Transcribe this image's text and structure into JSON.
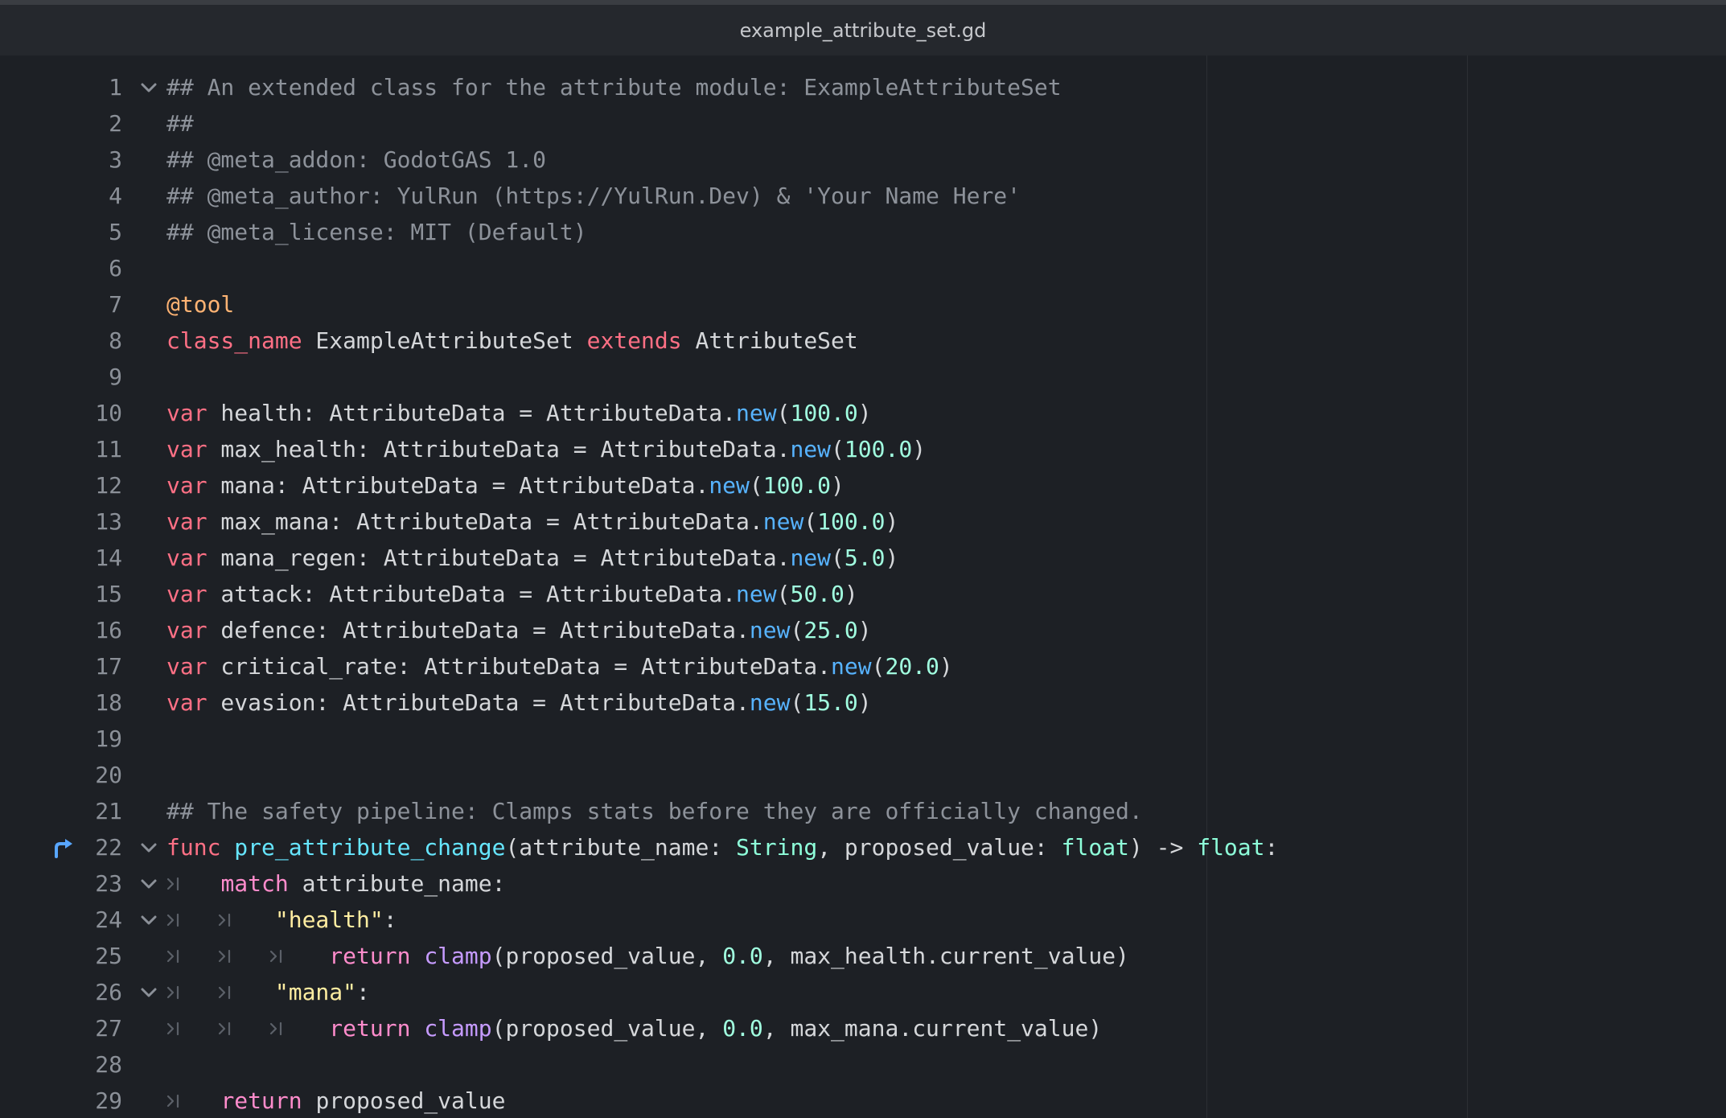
{
  "window": {
    "title": "example_attribute_set.gd"
  },
  "editor": {
    "lines": [
      {
        "n": "1",
        "tokens": [
          [
            "cm",
            "## An extended class for the attribute module: ExampleAttributeSet"
          ]
        ]
      },
      {
        "n": "2",
        "tokens": [
          [
            "cm",
            "##"
          ]
        ]
      },
      {
        "n": "3",
        "tokens": [
          [
            "cm",
            "## @meta_addon: GodotGAS 1.0"
          ]
        ]
      },
      {
        "n": "4",
        "tokens": [
          [
            "cm",
            "## @meta_author: YulRun (https://YulRun.Dev) & 'Your Name Here'"
          ]
        ]
      },
      {
        "n": "5",
        "tokens": [
          [
            "cm",
            "## @meta_license: MIT (Default)"
          ]
        ]
      },
      {
        "n": "6",
        "tokens": []
      },
      {
        "n": "7",
        "tokens": [
          [
            "an",
            "@tool"
          ]
        ]
      },
      {
        "n": "8",
        "tokens": [
          [
            "kw",
            "class_name"
          ],
          [
            "id",
            " ExampleAttributeSet "
          ],
          [
            "kw",
            "extends"
          ],
          [
            "id",
            " AttributeSet"
          ]
        ]
      },
      {
        "n": "9",
        "tokens": []
      },
      {
        "n": "10",
        "tokens": [
          [
            "kw",
            "var"
          ],
          [
            "id",
            " health: AttributeData = AttributeData."
          ],
          [
            "fn",
            "new"
          ],
          [
            "id",
            "("
          ],
          [
            "nm",
            "100.0"
          ],
          [
            "id",
            ")"
          ]
        ]
      },
      {
        "n": "11",
        "tokens": [
          [
            "kw",
            "var"
          ],
          [
            "id",
            " max_health: AttributeData = AttributeData."
          ],
          [
            "fn",
            "new"
          ],
          [
            "id",
            "("
          ],
          [
            "nm",
            "100.0"
          ],
          [
            "id",
            ")"
          ]
        ]
      },
      {
        "n": "12",
        "tokens": [
          [
            "kw",
            "var"
          ],
          [
            "id",
            " mana: AttributeData = AttributeData."
          ],
          [
            "fn",
            "new"
          ],
          [
            "id",
            "("
          ],
          [
            "nm",
            "100.0"
          ],
          [
            "id",
            ")"
          ]
        ]
      },
      {
        "n": "13",
        "tokens": [
          [
            "kw",
            "var"
          ],
          [
            "id",
            " max_mana: AttributeData = AttributeData."
          ],
          [
            "fn",
            "new"
          ],
          [
            "id",
            "("
          ],
          [
            "nm",
            "100.0"
          ],
          [
            "id",
            ")"
          ]
        ]
      },
      {
        "n": "14",
        "tokens": [
          [
            "kw",
            "var"
          ],
          [
            "id",
            " mana_regen: AttributeData = AttributeData."
          ],
          [
            "fn",
            "new"
          ],
          [
            "id",
            "("
          ],
          [
            "nm",
            "5.0"
          ],
          [
            "id",
            ")"
          ]
        ]
      },
      {
        "n": "15",
        "tokens": [
          [
            "kw",
            "var"
          ],
          [
            "id",
            " attack: AttributeData = AttributeData."
          ],
          [
            "fn",
            "new"
          ],
          [
            "id",
            "("
          ],
          [
            "nm",
            "50.0"
          ],
          [
            "id",
            ")"
          ]
        ]
      },
      {
        "n": "16",
        "tokens": [
          [
            "kw",
            "var"
          ],
          [
            "id",
            " defence: AttributeData = AttributeData."
          ],
          [
            "fn",
            "new"
          ],
          [
            "id",
            "("
          ],
          [
            "nm",
            "25.0"
          ],
          [
            "id",
            ")"
          ]
        ]
      },
      {
        "n": "17",
        "tokens": [
          [
            "kw",
            "var"
          ],
          [
            "id",
            " critical_rate: AttributeData = AttributeData."
          ],
          [
            "fn",
            "new"
          ],
          [
            "id",
            "("
          ],
          [
            "nm",
            "20.0"
          ],
          [
            "id",
            ")"
          ]
        ]
      },
      {
        "n": "18",
        "tokens": [
          [
            "kw",
            "var"
          ],
          [
            "id",
            " evasion: AttributeData = AttributeData."
          ],
          [
            "fn",
            "new"
          ],
          [
            "id",
            "("
          ],
          [
            "nm",
            "15.0"
          ],
          [
            "id",
            ")"
          ]
        ]
      },
      {
        "n": "19",
        "tokens": []
      },
      {
        "n": "20",
        "tokens": []
      },
      {
        "n": "21",
        "tokens": [
          [
            "cm",
            "## The safety pipeline: Clamps stats before they are officially changed."
          ]
        ]
      },
      {
        "n": "22",
        "tokens": [
          [
            "kw",
            "func"
          ],
          [
            "id",
            " "
          ],
          [
            "fn2",
            "pre_attribute_change"
          ],
          [
            "id",
            "(attribute_name: "
          ],
          [
            "ty",
            "String"
          ],
          [
            "id",
            ", proposed_value: "
          ],
          [
            "ty",
            "float"
          ],
          [
            "id",
            ") -> "
          ],
          [
            "ty",
            "float"
          ],
          [
            "id",
            ":"
          ]
        ]
      },
      {
        "n": "23",
        "tokens": [
          [
            "id",
            "    "
          ],
          [
            "ctl",
            "match"
          ],
          [
            "id",
            " attribute_name:"
          ]
        ]
      },
      {
        "n": "24",
        "tokens": [
          [
            "id",
            "        "
          ],
          [
            "st",
            "\"health\""
          ],
          [
            "id",
            ":"
          ]
        ]
      },
      {
        "n": "25",
        "tokens": [
          [
            "id",
            "            "
          ],
          [
            "ctl",
            "return"
          ],
          [
            "id",
            " "
          ],
          [
            "bi",
            "clamp"
          ],
          [
            "id",
            "(proposed_value, "
          ],
          [
            "nm",
            "0.0"
          ],
          [
            "id",
            ", max_health.current_value)"
          ]
        ]
      },
      {
        "n": "26",
        "tokens": [
          [
            "id",
            "        "
          ],
          [
            "st",
            "\"mana\""
          ],
          [
            "id",
            ":"
          ]
        ]
      },
      {
        "n": "27",
        "tokens": [
          [
            "id",
            "            "
          ],
          [
            "ctl",
            "return"
          ],
          [
            "id",
            " "
          ],
          [
            "bi",
            "clamp"
          ],
          [
            "id",
            "(proposed_value, "
          ],
          [
            "nm",
            "0.0"
          ],
          [
            "id",
            ", max_mana.current_value)"
          ]
        ]
      },
      {
        "n": "28",
        "tokens": []
      },
      {
        "n": "29",
        "tokens": [
          [
            "id",
            "    "
          ],
          [
            "ctl",
            "return"
          ],
          [
            "id",
            " proposed_value"
          ]
        ]
      }
    ],
    "fold_lines": [
      "1",
      "22",
      "23",
      "24",
      "26"
    ],
    "tab_marks": {
      "23": 1,
      "24": 2,
      "25": 3,
      "26": 2,
      "27": 3,
      "29": 1
    },
    "breakpoint_line": "22"
  }
}
